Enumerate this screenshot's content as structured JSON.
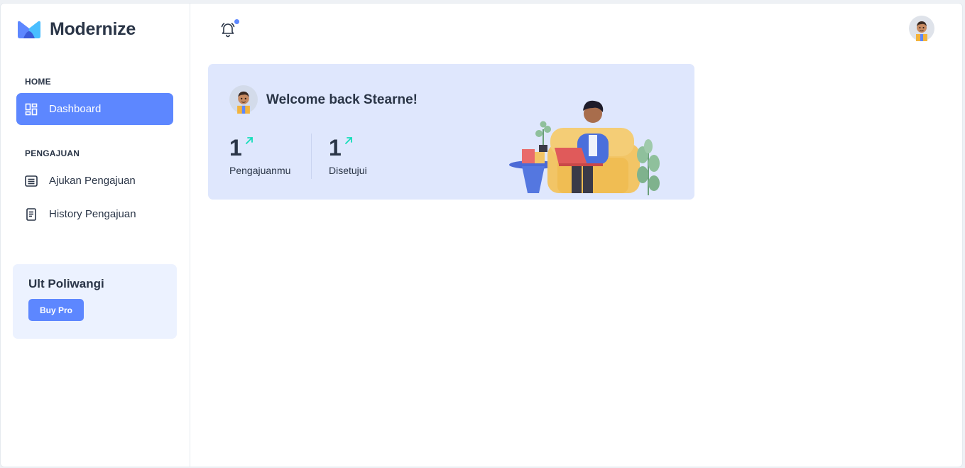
{
  "brand": {
    "name": "Modernize"
  },
  "sidebar": {
    "sections": [
      {
        "label": "HOME"
      },
      {
        "label": "PENGAJUAN"
      }
    ],
    "items": [
      {
        "label": "Dashboard",
        "icon": "dashboard-icon",
        "active": true
      },
      {
        "label": "Ajukan Pengajuan",
        "icon": "list-icon",
        "active": false
      },
      {
        "label": "History Pengajuan",
        "icon": "document-icon",
        "active": false
      }
    ],
    "promo": {
      "title": "Ult Poliwangi",
      "button_label": "Buy Pro"
    }
  },
  "header": {
    "notification_icon": "bell-icon",
    "has_notification": true,
    "avatar": "user-avatar"
  },
  "welcome": {
    "title": "Welcome back Stearne!",
    "stats": [
      {
        "value": "1",
        "label": "Pengajuanmu"
      },
      {
        "value": "1",
        "label": "Disetujui"
      }
    ]
  },
  "colors": {
    "primary": "#5d87ff",
    "card_bg": "#dfe7fd",
    "promo_bg": "#ecf2ff",
    "text": "#2a3547",
    "success": "#13deb9"
  }
}
